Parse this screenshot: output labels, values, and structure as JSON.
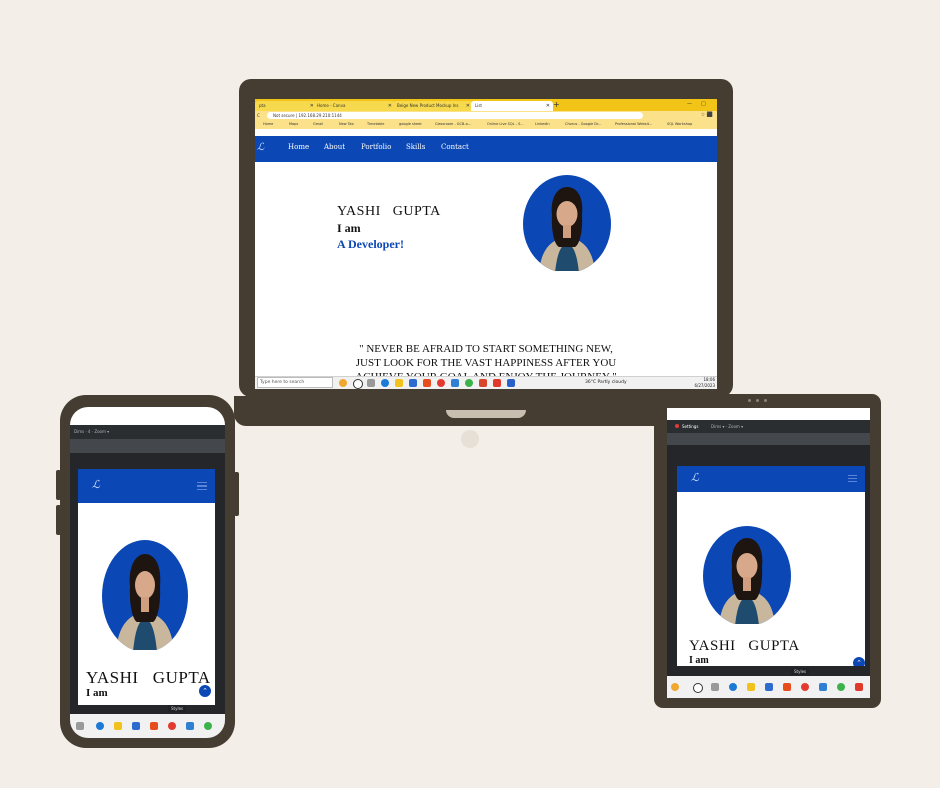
{
  "laptop": {
    "tabs": [
      {
        "label": "pta"
      },
      {
        "label": "Home - Canva"
      },
      {
        "label": "Beige New Product Mockup Ins"
      },
      {
        "label": "List"
      }
    ],
    "address": "Not secure | 192.168.29.210:1144",
    "bookmarks": [
      "Home",
      "Maps",
      "Gmail",
      "New Tab",
      "Timetable",
      "google sheet",
      "Classroom - GCB-o...",
      "Online Live SQL - S...",
      "Linkedin",
      "Chorus - Google Dr...",
      "Professional Websit...",
      "SQL Workshop"
    ],
    "site": {
      "logo": "ℒ",
      "nav": [
        "Home",
        "About",
        "Portfolio",
        "Skills",
        "Contact"
      ],
      "name": "YASHI   GUPTA",
      "iam": "I am",
      "role": "A Developer!",
      "quote_lines": [
        "\" NEVER BE AFRAID TO START SOMETHING NEW,",
        "JUST LOOK FOR THE VAST HAPPINESS AFTER YOU",
        "ACHIEVE YOUR GOAL AND ENJOY THE JOURNEY \""
      ]
    },
    "taskbar": {
      "search_placeholder": "Type here to search",
      "weather": "36°C  Partly cloudy",
      "lang": "ENG IN",
      "time": "18:06",
      "date": "6/27/2023"
    }
  },
  "phone": {
    "devtools": "Dims · 4 · Zoom ▾",
    "logo": "ℒ",
    "name": "YASHI   GUPTA",
    "iam": "I am",
    "tooltip": "Styles"
  },
  "tablet": {
    "devtools_label": "Settings",
    "devtools_rest": "Dims ▾ · Zoom ▾",
    "logo": "ℒ",
    "name": "YASHI   GUPTA",
    "iam": "I am",
    "tooltip": "Styles"
  },
  "colors": {
    "background": "#f3efe8",
    "device": "#463d32",
    "brand_blue": "#0b47b5"
  }
}
